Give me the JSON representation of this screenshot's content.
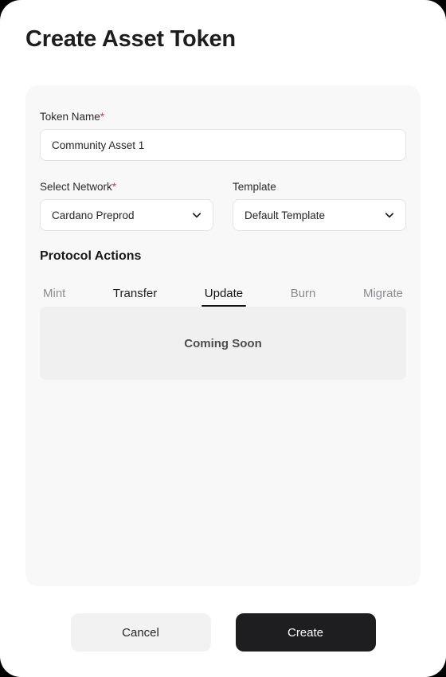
{
  "window": {
    "background_color": "#000000",
    "surface_color": "#ffffff"
  },
  "header": {
    "title": "Create Asset Token"
  },
  "form": {
    "token_name": {
      "label": "Token Name",
      "required_marker": "*",
      "value": "Community Asset 1",
      "placeholder": "Community Asset 1"
    },
    "select_network": {
      "label": "Select Network",
      "required_marker": "*",
      "value": "Cardano Preprod",
      "icon": "chevron-down-icon"
    },
    "template": {
      "label": "Template",
      "value": "Default Template",
      "icon": "chevron-down-icon"
    },
    "protocol_actions": {
      "heading": "Protocol Actions",
      "tabs": [
        {
          "label": "Mint",
          "state": "inactive"
        },
        {
          "label": "Transfer",
          "state": "hovered"
        },
        {
          "label": "Update",
          "state": "active"
        },
        {
          "label": "Burn",
          "state": "inactive"
        },
        {
          "label": "Migrate",
          "state": "inactive"
        }
      ],
      "panel": {
        "message": "Coming Soon"
      }
    }
  },
  "footer": {
    "cancel_label": "Cancel",
    "create_label": "Create",
    "create_bg_color": "#1e1e20",
    "cancel_bg_color": "#f2f2f3"
  },
  "colors": {
    "required_star": "#e0323c",
    "card_background": "#f8f8f9",
    "panel_background": "#f0f0f1",
    "text_primary": "#1d1d1f",
    "text_muted": "#8c8c93"
  }
}
